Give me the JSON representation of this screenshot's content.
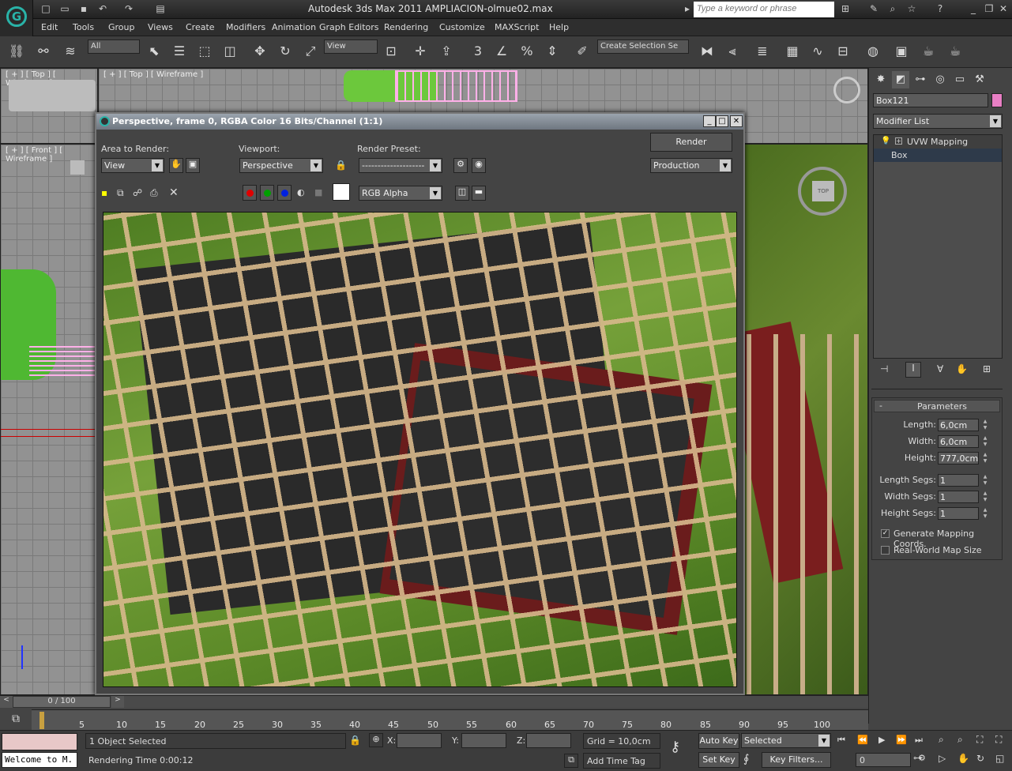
{
  "app": {
    "title": "Autodesk 3ds Max  2011     AMPLIACION-olmue02.max",
    "search_placeholder": "Type a keyword or phrase",
    "logo": "G"
  },
  "menu": [
    "Edit",
    "Tools",
    "Group",
    "Views",
    "Create",
    "Modifiers",
    "Animation",
    "Graph Editors",
    "Rendering",
    "Customize",
    "MAXScript",
    "Help"
  ],
  "toolbar": {
    "filter_select": "All",
    "ref_coord": "View",
    "selection_set": "Create Selection Se",
    "snap_label": "3"
  },
  "viewports": {
    "top_left": "[ + ] [ Top ] [ Wireframe ]",
    "top_right": "[ + ] [ Top ] [ Wireframe ]",
    "front": "[ + ] [ Front ] [ Wireframe ]",
    "viewcube_top": "TOP"
  },
  "command_panel": {
    "object_name": "Box121",
    "modifier_list": "Modifier List",
    "stack": [
      "UVW Mapping",
      "Box"
    ],
    "color": "#e87fc4",
    "params": {
      "title": "Parameters",
      "collapse": "-",
      "length_label": "Length:",
      "length": "6,0cm",
      "width_label": "Width:",
      "width": "6,0cm",
      "height_label": "Height:",
      "height": "777,0cm",
      "lsegs_label": "Length Segs:",
      "lsegs": "1",
      "wsegs_label": "Width Segs:",
      "wsegs": "1",
      "hsegs_label": "Height Segs:",
      "hsegs": "1",
      "gen_map": "Generate Mapping Coords.",
      "real_world": "Real-World Map Size"
    }
  },
  "render_window": {
    "title": "Perspective, frame 0, RGBA Color 16 Bits/Channel (1:1)",
    "area_label": "Area to Render:",
    "area": "View",
    "viewport_label": "Viewport:",
    "viewport": "Perspective",
    "preset_label": "Render Preset:",
    "preset": "--------------------",
    "render_btn": "Render",
    "mode": "Production",
    "channel": "RGB Alpha",
    "colors": {
      "red": "#e00000",
      "green": "#00a000",
      "blue": "#0020e0"
    }
  },
  "timeline": {
    "frame": "0 / 100",
    "ticks": [
      "5",
      "10",
      "15",
      "20",
      "25",
      "30",
      "35",
      "40",
      "45",
      "50",
      "55",
      "60",
      "65",
      "70",
      "75",
      "80",
      "85",
      "90",
      "95",
      "100"
    ]
  },
  "status": {
    "maxscript": "Welcome to M.",
    "selected": "1 Object Selected",
    "render_time": "Rendering Time  0:00:12",
    "x_label": "X:",
    "y_label": "Y:",
    "z_label": "Z:",
    "grid": "Grid = 10,0cm",
    "add_time_tag": "Add Time Tag",
    "auto_key": "Auto Key",
    "set_key": "Set Key",
    "key_mode": "Selected",
    "key_filters": "Key Filters...",
    "frame_value": "0"
  }
}
